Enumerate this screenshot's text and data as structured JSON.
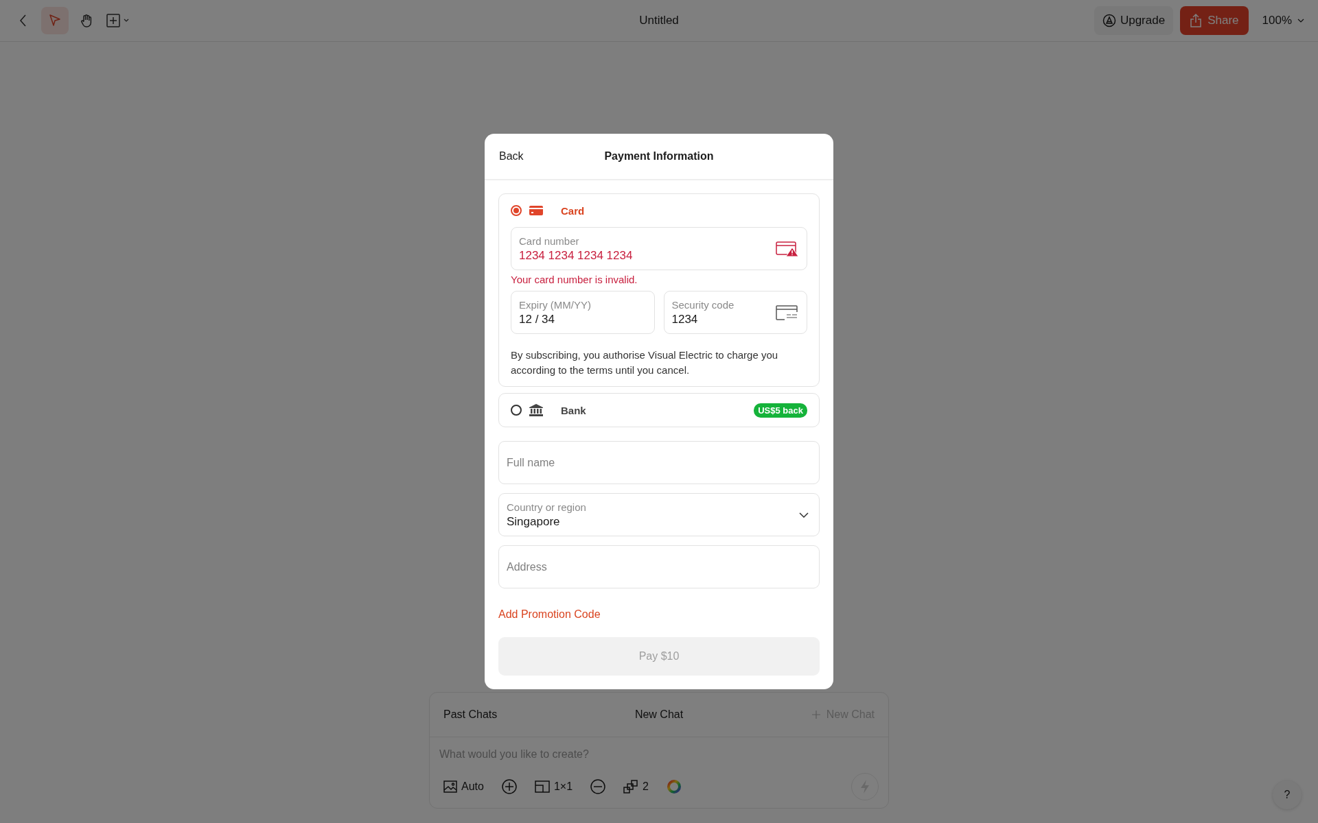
{
  "toolbar": {
    "tools": [
      {
        "kind": "pointer",
        "selected": true
      },
      {
        "kind": "hand",
        "selected": false
      },
      {
        "kind": "frame",
        "selected": false
      }
    ],
    "title": "Untitled",
    "upgrade": "Upgrade",
    "share": "Share",
    "zoom": "100%"
  },
  "chat": {
    "tabs": [
      {
        "label": "Past Chats"
      },
      {
        "label": "New Chat"
      }
    ],
    "new_chat": "New Chat",
    "prompt": {
      "placeholder": "What would you like to create?"
    },
    "options": [
      {
        "kind": "image",
        "label": "Auto"
      },
      {
        "kind": "add"
      },
      {
        "kind": "aspect",
        "label": "1×1"
      },
      {
        "kind": "remove"
      },
      {
        "kind": "count",
        "label": "2"
      },
      {
        "kind": "color"
      }
    ]
  },
  "help": "?",
  "modal": {
    "back": "Back",
    "title": "Payment Information",
    "methods": [
      {
        "kind": "card",
        "label": "Card",
        "selected": true,
        "card_number": {
          "label": "Card number",
          "value": "1234 1234 1234 1234",
          "invalid": true
        },
        "error": "Your card number is invalid.",
        "expiry": {
          "label": "Expiry (MM/YY)",
          "value": "12 / 34"
        },
        "security_code": {
          "label": "Security code",
          "value": "1234"
        },
        "notice": "By subscribing, you authorise Visual Electric to charge you according to the terms until you cancel."
      },
      {
        "kind": "bank",
        "label": "Bank",
        "selected": false,
        "badge": "US$5 back"
      }
    ],
    "full_name": {
      "placeholder": "Full name"
    },
    "country": {
      "label": "Country or region",
      "value": "Singapore"
    },
    "address": {
      "placeholder": "Address"
    },
    "promo": "Add Promotion Code",
    "pay": {
      "label": "Pay $10",
      "disabled": true
    }
  }
}
